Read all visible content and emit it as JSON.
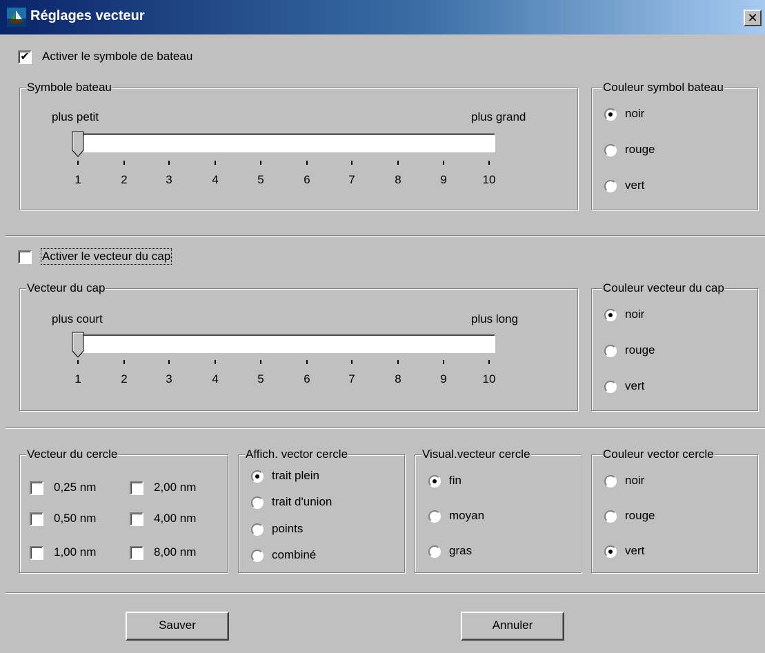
{
  "window": {
    "title": "Réglages vecteur",
    "close_label": "✕"
  },
  "boat": {
    "enable_label": "Activer le symbole de bateau",
    "enable_checked": true,
    "group_label": "Symbole bateau",
    "min_label": "plus petit",
    "max_label": "plus grand",
    "ticks": [
      "1",
      "2",
      "3",
      "4",
      "5",
      "6",
      "7",
      "8",
      "9",
      "10"
    ],
    "value": 1,
    "color_group_label": "Couleur symbol bateau",
    "color_options": [
      "noir",
      "rouge",
      "vert"
    ],
    "color_selected": 0
  },
  "heading": {
    "enable_label": "Activer le vecteur du cap",
    "enable_checked": false,
    "group_label": "Vecteur du cap",
    "min_label": "plus court",
    "max_label": "plus long",
    "ticks": [
      "1",
      "2",
      "3",
      "4",
      "5",
      "6",
      "7",
      "8",
      "9",
      "10"
    ],
    "value": 1,
    "color_group_label": "Couleur vecteur du cap",
    "color_options": [
      "noir",
      "rouge",
      "vert"
    ],
    "color_selected": 0
  },
  "circle": {
    "group_label": "Vecteur du cercle",
    "distances": [
      "0,25 nm",
      "2,00 nm",
      "0,50 nm",
      "4,00 nm",
      "1,00 nm",
      "8,00 nm"
    ],
    "display_group_label": "Affich. vector cercle",
    "display_options": [
      "trait plein",
      "trait d'union",
      "points",
      "combiné"
    ],
    "display_selected": 0,
    "visual_group_label": "Visual.vecteur cercle",
    "visual_options": [
      "fin",
      "moyan",
      "gras"
    ],
    "visual_selected": 0,
    "color_group_label": "Couleur vector cercle",
    "color_options": [
      "noir",
      "rouge",
      "vert"
    ],
    "color_selected": 2
  },
  "buttons": {
    "save": "Sauver",
    "cancel": "Annuler"
  },
  "icons": {
    "app": "boat-app-icon",
    "close": "close-icon"
  }
}
